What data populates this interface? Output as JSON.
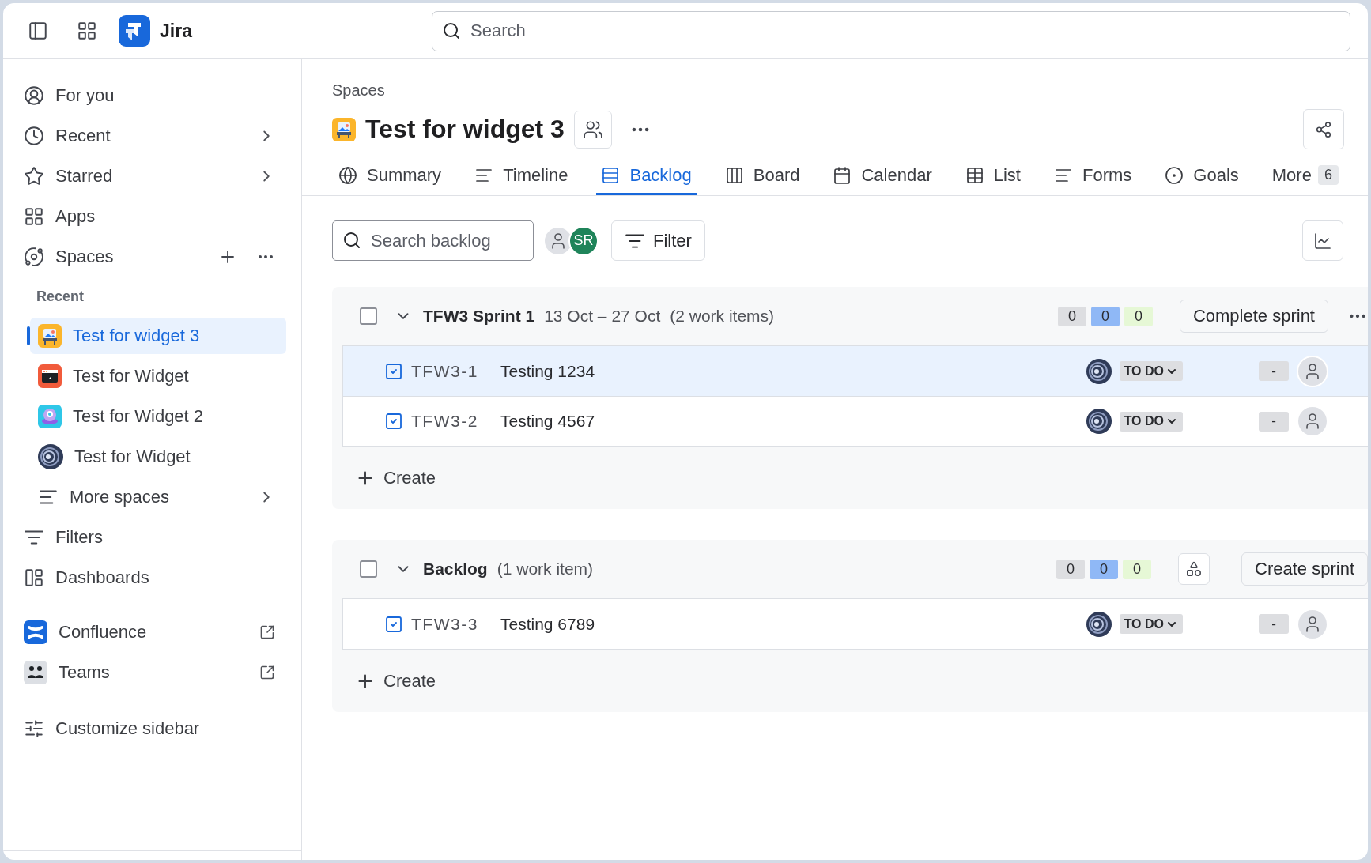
{
  "topbar": {
    "product": "Jira",
    "search": {
      "placeholder": "Search"
    }
  },
  "sidebar": {
    "items": [
      {
        "kind": "nav",
        "label": "For you",
        "chevron": false
      },
      {
        "kind": "nav",
        "label": "Recent",
        "chevron": true
      },
      {
        "kind": "nav",
        "label": "Starred",
        "chevron": true
      },
      {
        "kind": "nav",
        "label": "Apps",
        "chevron": false
      },
      {
        "kind": "spaces",
        "label": "Spaces",
        "chevron": false
      },
      {
        "kind": "heading",
        "label": "Recent"
      },
      {
        "kind": "space",
        "label": "Test for widget 3",
        "selected": true
      },
      {
        "kind": "space",
        "label": "Test for Widget",
        "selected": false
      },
      {
        "kind": "space",
        "label": "Test for Widget 2",
        "selected": false
      },
      {
        "kind": "space",
        "label": "Test for Widget",
        "selected": false
      },
      {
        "kind": "more",
        "label": "More spaces",
        "chevron": true
      },
      {
        "kind": "nav",
        "label": "Filters",
        "chevron": false
      },
      {
        "kind": "nav",
        "label": "Dashboards",
        "chevron": false
      },
      {
        "kind": "app",
        "label": "Confluence",
        "external": true
      },
      {
        "kind": "app",
        "label": "Teams",
        "external": true
      },
      {
        "kind": "customize",
        "label": "Customize sidebar"
      }
    ]
  },
  "header": {
    "breadcrumb": "Spaces",
    "title": "Test for widget 3"
  },
  "tabs": [
    {
      "label": "Summary",
      "selected": false
    },
    {
      "label": "Timeline",
      "selected": false
    },
    {
      "label": "Backlog",
      "selected": true
    },
    {
      "label": "Board",
      "selected": false
    },
    {
      "label": "Calendar",
      "selected": false
    },
    {
      "label": "List",
      "selected": false
    },
    {
      "label": "Forms",
      "selected": false
    },
    {
      "label": "Goals",
      "selected": false
    },
    {
      "label": "More",
      "selected": false,
      "count": "6"
    }
  ],
  "toolbar": {
    "search": {
      "placeholder": "Search backlog"
    },
    "people": [
      {
        "kind": "unassigned"
      },
      {
        "kind": "initials",
        "initials": "SR",
        "color": "#1f845a"
      }
    ],
    "filter": "Filter"
  },
  "sprints": [
    {
      "kind": "sprint",
      "name": "TFW3 Sprint 1",
      "dates": "13 Oct – 27 Oct",
      "count": "(2 work items)",
      "checked": false,
      "expanded": true,
      "counts": [
        {
          "value": "0",
          "color": "#dddee1"
        },
        {
          "value": "0",
          "color": "#8fb8f6"
        },
        {
          "value": "0",
          "color": "#e6f8d6"
        }
      ],
      "action": "Complete sprint",
      "items": [
        {
          "key": "TFW3-1",
          "summary": "Testing 1234",
          "status": "TO DO",
          "estimate": "-",
          "selected": true
        },
        {
          "key": "TFW3-2",
          "summary": "Testing 4567",
          "status": "TO DO",
          "estimate": "-",
          "selected": false
        }
      ],
      "create": "Create"
    },
    {
      "kind": "backlog",
      "name": "Backlog",
      "count": "(1 work item)",
      "checked": false,
      "expanded": true,
      "counts": [
        {
          "value": "0",
          "color": "#dddee1"
        },
        {
          "value": "0",
          "color": "#8fb8f6"
        },
        {
          "value": "0",
          "color": "#e6f8d6"
        }
      ],
      "action": "Create sprint",
      "items": [
        {
          "key": "TFW3-3",
          "summary": "Testing 6789",
          "status": "TO DO",
          "estimate": "-",
          "selected": false
        }
      ],
      "create": "Create"
    }
  ]
}
